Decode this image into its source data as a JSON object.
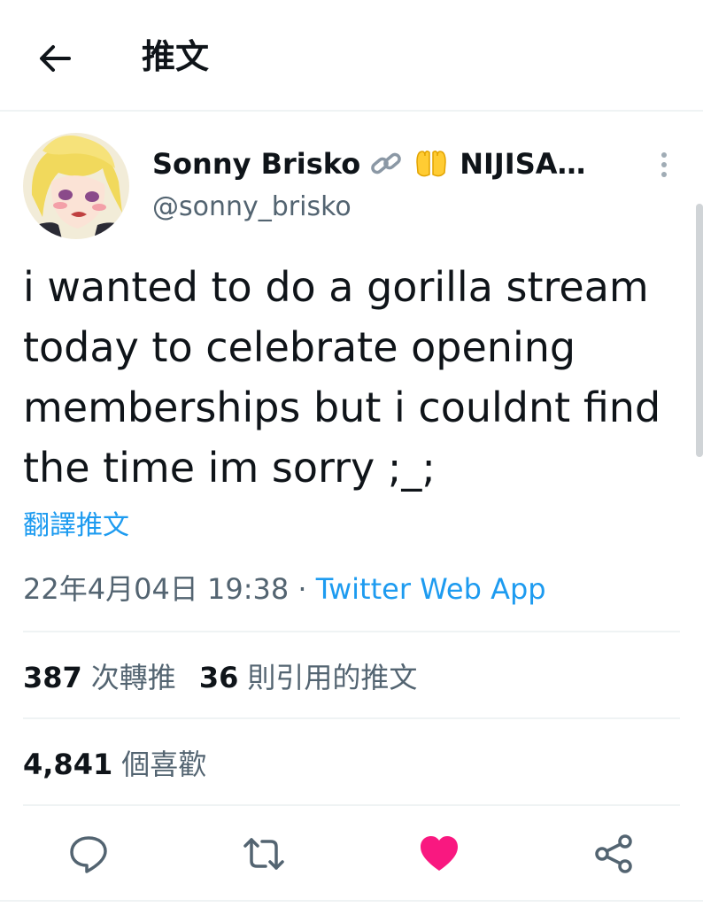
{
  "header": {
    "title": "推文",
    "back_icon": "arrow-left-icon"
  },
  "author": {
    "name": "Sonny Brisko",
    "name_suffix": "NIJISA…",
    "handle": "@sonny_brisko",
    "badge_icons": [
      "link-icon",
      "raised-hands-icon"
    ]
  },
  "tweet": {
    "lines": [
      "i wanted to do a gorilla stream",
      "today to celebrate opening",
      "memberships but i couldnt find",
      "the time im sorry ;_;"
    ],
    "translate_label": "翻譯推文",
    "timestamp": "22年4月04日 19:38",
    "separator": " · ",
    "source": "Twitter Web App"
  },
  "stats": {
    "retweets_count": "387",
    "retweets_label": "次轉推",
    "quotes_count": "36",
    "quotes_label": "則引用的推文",
    "likes_count": "4,841",
    "likes_label": "個喜歡"
  },
  "actions": [
    "reply-icon",
    "retweet-icon",
    "like-icon",
    "share-icon"
  ],
  "colors": {
    "accent": "#1d9bf0",
    "like": "#f91880",
    "muted": "#536471",
    "text": "#0f1419"
  }
}
